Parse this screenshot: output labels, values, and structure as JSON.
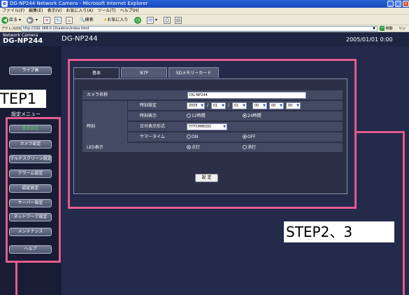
{
  "browser": {
    "title": "DG-NP244 Network Camera - Microsoft Internet Explorer",
    "menu": [
      "ファイル(F)",
      "編集(E)",
      "表示(V)",
      "お気に入り(A)",
      "ツール(T)",
      "ヘルプ(H)"
    ],
    "toolbar": {
      "back": "戻る",
      "search": "検索",
      "favorites": "お気に入り"
    },
    "address_label": "アドレス(D)",
    "address_url": "http://192.168.0.10/admin/index.html",
    "go_label": "移動",
    "links_label": "リン"
  },
  "header": {
    "brand_line1": "Network Camera",
    "brand_line2": "DG-NP244",
    "model": "DG-NP244",
    "datetime": "2005/01/01  0:00"
  },
  "sidebar": {
    "live_button": "ライブ画",
    "settings_menu_label": "設定メニュー",
    "items": [
      {
        "label": "基本設定",
        "active": true
      },
      {
        "label": "カメラ設定",
        "active": false
      },
      {
        "label": "マルチスクリーン設定",
        "active": false
      },
      {
        "label": "アラーム設定",
        "active": false
      },
      {
        "label": "認証設定",
        "active": false
      },
      {
        "label": "サーバー設定",
        "active": false
      },
      {
        "label": "ネットワーク設定",
        "active": false
      },
      {
        "label": "メンテナンス",
        "active": false
      },
      {
        "label": "ヘルプ",
        "active": false
      }
    ]
  },
  "tabs": [
    {
      "label": "基本",
      "active": true
    },
    {
      "label": "NTP",
      "active": false
    },
    {
      "label": "SDメモリーカード",
      "active": false
    }
  ],
  "settings": {
    "camera_name_label": "カメラ名称",
    "camera_name_value": "DG-NP244",
    "clock_group_label": "時刻",
    "time_setting_label": "時刻設定",
    "time_values": {
      "year": "2005",
      "month": "01",
      "day": "01",
      "hour": "00",
      "minute": "00",
      "second": "00"
    },
    "date_sep": "/",
    "time_display_label": "時刻表示",
    "time_display_12h": "12時間",
    "time_display_24h": "24時間",
    "date_format_label": "日付表示形式",
    "date_format_value": "YYYY/MM/DD",
    "summer_time_label": "サマータイム",
    "summer_on": "ON",
    "summer_off": "OFF",
    "led_label": "LED表示",
    "led_on": "点灯",
    "led_off": "消灯",
    "set_button": "設 定"
  },
  "annotations": {
    "step1": "TEP1",
    "step23": "STEP2、3",
    "color": "#e35b8e"
  }
}
